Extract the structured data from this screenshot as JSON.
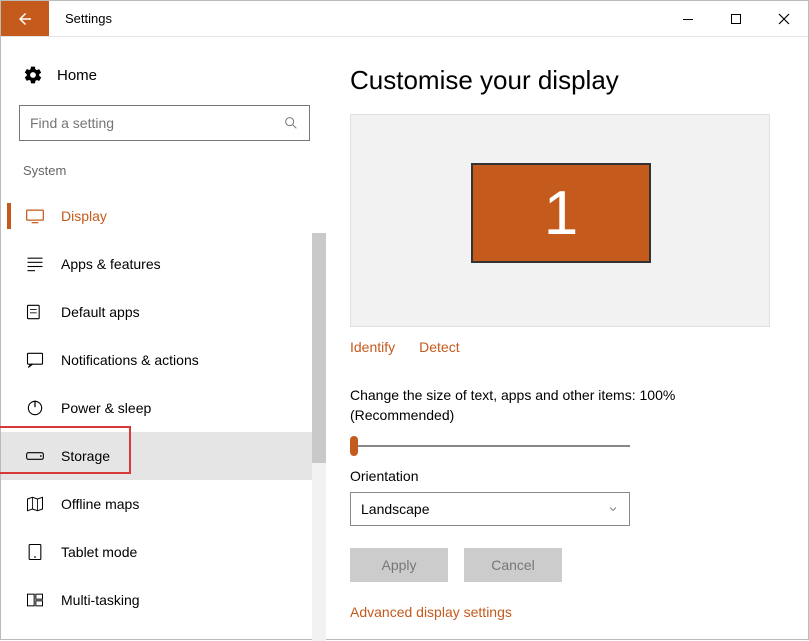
{
  "window": {
    "title": "Settings"
  },
  "sidebar": {
    "home_label": "Home",
    "search_placeholder": "Find a setting",
    "section": "System",
    "items": [
      {
        "label": "Display"
      },
      {
        "label": "Apps & features"
      },
      {
        "label": "Default apps"
      },
      {
        "label": "Notifications & actions"
      },
      {
        "label": "Power & sleep"
      },
      {
        "label": "Storage"
      },
      {
        "label": "Offline maps"
      },
      {
        "label": "Tablet mode"
      },
      {
        "label": "Multi-tasking"
      }
    ]
  },
  "main": {
    "heading": "Customise your display",
    "monitor_number": "1",
    "identify": "Identify",
    "detect": "Detect",
    "size_text": "Change the size of text, apps and other items: 100% (Recommended)",
    "orientation_label": "Orientation",
    "orientation_value": "Landscape",
    "apply": "Apply",
    "cancel": "Cancel",
    "advanced": "Advanced display settings"
  }
}
